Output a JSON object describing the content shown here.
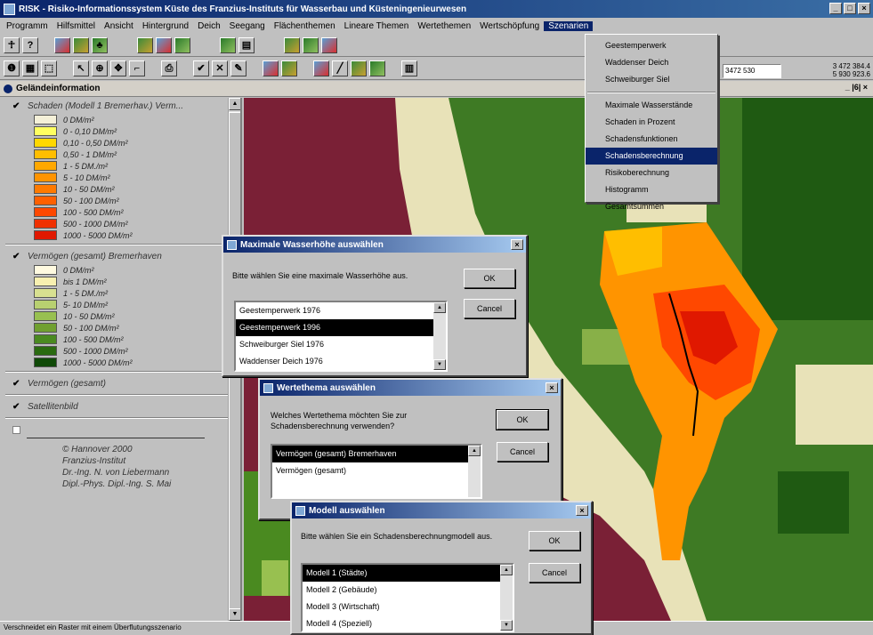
{
  "window": {
    "title": "RISK - Risiko-Informationssystem Küste des Franzius-Instituts für Wasserbau und Küsteningenieurwesen",
    "controls": [
      "_",
      "□",
      "×"
    ]
  },
  "menu": [
    "Programm",
    "Hilfsmittel",
    "Ansicht",
    "Hintergrund",
    "Deich",
    "Seegang",
    "Flächenthemen",
    "Lineare Themen",
    "Wertethemen",
    "Wertschöpfung",
    "Szenarien"
  ],
  "toolbar": {
    "coord_value": "3472 530",
    "coord_readout": "3 472 384.4\n5 930 923.6"
  },
  "panel": {
    "title": "Geländeinformation",
    "right_tool": "_ |6| ×"
  },
  "legend": {
    "group1": {
      "title": "Schaden (Modell 1 Bremerhav.) Verm...",
      "items": [
        {
          "label": "0 DM/m²",
          "color": "#f4f0d8"
        },
        {
          "label": "0 - 0,10 DM/m²",
          "color": "#ffff60"
        },
        {
          "label": "0,10 - 0,50 DM/m²",
          "color": "#ffd800"
        },
        {
          "label": "0,50 - 1 DM/m²",
          "color": "#ffbe00"
        },
        {
          "label": "1 - 5 DM./m²",
          "color": "#ffa800"
        },
        {
          "label": "5 - 10 DM/m²",
          "color": "#ff9400"
        },
        {
          "label": "10 - 50 DM/m²",
          "color": "#ff7a00"
        },
        {
          "label": "50 - 100 DM/m²",
          "color": "#ff6000"
        },
        {
          "label": "100 - 500 DM/m²",
          "color": "#ff4800"
        },
        {
          "label": "500 - 1000 DM/m²",
          "color": "#f03000"
        },
        {
          "label": "1000 - 5000 DM/m²",
          "color": "#e01800"
        }
      ]
    },
    "group2": {
      "title": "Vermögen (gesamt) Bremerhaven",
      "items": [
        {
          "label": "0 DM/m²",
          "color": "#fffae0"
        },
        {
          "label": "bis 1 DM/m²",
          "color": "#f8f0b0"
        },
        {
          "label": "1 - 5 DM./m²",
          "color": "#d8e090"
        },
        {
          "label": "5- 10 DM/m²",
          "color": "#b8d070"
        },
        {
          "label": "10 - 50 DM/m²",
          "color": "#98c050"
        },
        {
          "label": "50 - 100 DM/m²",
          "color": "#70a030"
        },
        {
          "label": "100 - 500 DM/m²",
          "color": "#4a8a20"
        },
        {
          "label": "500 - 1000 DM/m²",
          "color": "#2a6a10"
        },
        {
          "label": "1000 - 5000 DM/m²",
          "color": "#104a08"
        }
      ]
    },
    "group3": "Vermögen (gesamt)",
    "group4": "Satellitenbild",
    "credits": [
      "© Hannover 2000",
      "Franzius-Institut",
      "Dr.-Ing. N. von Liebermann",
      "Dipl.-Phys. Dipl.-Ing. S. Mai"
    ]
  },
  "dropdown": {
    "items": [
      "Geestemperwerk",
      "Waddenser Deich",
      "Schweiburger Siel",
      "Maximale Wasserstände",
      "Schaden in Prozent",
      "Schadensfunktionen",
      "Schadensberechnung",
      "Risikoberechnung",
      "Histogramm",
      "Gesamtsummen"
    ],
    "selected_index": 6
  },
  "dialog1": {
    "title": "Maximale Wasserhöhe auswählen",
    "prompt": "Bitte wählen Sie eine maximale Wasserhöhe aus.",
    "items": [
      "Geestemperwerk 1976",
      "Geestemperwerk 1996",
      "Schweiburger Siel 1976",
      "Waddenser Deich 1976"
    ],
    "selected_index": 1,
    "ok": "OK",
    "cancel": "Cancel"
  },
  "dialog2": {
    "title": "Wertethema auswählen",
    "prompt": "Welches Wertethema möchten Sie zur Schadensberechnung verwenden?",
    "items": [
      "Vermögen (gesamt) Bremerhaven",
      "Vermögen (gesamt)"
    ],
    "selected_index": 0,
    "ok": "OK",
    "cancel": "Cancel"
  },
  "dialog3": {
    "title": "Modell auswählen",
    "prompt": "Bitte wählen Sie ein Schadensberechnungmodell aus.",
    "items": [
      "Modell 1 (Städte)",
      "Modell 2 (Gebäude)",
      "Modell 3 (Wirtschaft)",
      "Modell 4 (Speziell)"
    ],
    "selected_index": 0,
    "ok": "OK",
    "cancel": "Cancel"
  },
  "status": "Verschneidet ein Raster mit einem Überflutungsszenario",
  "colors": {
    "sea": "#7a2036",
    "titlebar": "#0a246a"
  }
}
